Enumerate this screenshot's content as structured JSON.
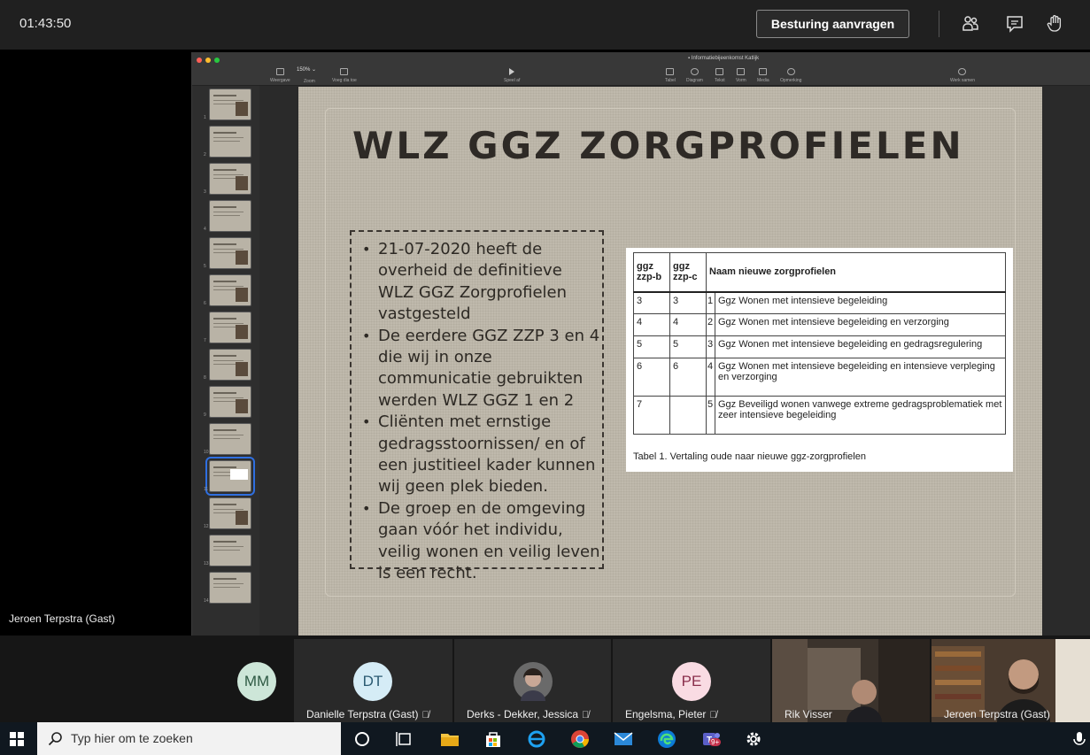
{
  "topbar": {
    "clock": "01:43:50",
    "request_control_label": "Besturing aanvragen"
  },
  "presenter": {
    "name": "Jeroen Terpstra (Gast)"
  },
  "keynote": {
    "doc_title": "Informatiebijeenkomst Katlijk",
    "zoom": "150% ⌄",
    "toolbar": {
      "view": "Weergave",
      "zoom": "Zoom",
      "add_slide": "Voeg dia toe",
      "play": "Speel af",
      "table": "Tabel",
      "chart": "Diagram",
      "text": "Tekst",
      "shape": "Vorm",
      "media": "Media",
      "comment": "Opmerking",
      "collaborate": "Werk samen"
    },
    "slide_numbers": [
      "1",
      "2",
      "3",
      "4",
      "5",
      "6",
      "7",
      "8",
      "9",
      "10",
      "11",
      "12",
      "13",
      "14"
    ]
  },
  "slide": {
    "title": "WLZ GGZ ZORGPROFIELEN",
    "bullets": [
      "21-07-2020 heeft de overheid de definitieve WLZ GGZ Zorgprofielen vastgesteld",
      "De eerdere GGZ ZZP 3 en 4 die wij in onze communicatie gebruikten werden WLZ GGZ 1 en 2",
      "Cliënten met ernstige gedragsstoornissen/ en of een justitieel kader kunnen wij geen plek bieden.",
      "De groep en de omgeving gaan vóór het individu, veilig wonen en veilig leven is een recht."
    ],
    "table": {
      "headers": [
        "ggz zzp-b",
        "ggz zzp-c",
        "Naam nieuwe zorgprofielen"
      ],
      "rows": [
        {
          "b": "3",
          "c": "3",
          "n": "1",
          "name": "Ggz Wonen met intensieve begeleiding"
        },
        {
          "b": "4",
          "c": "4",
          "n": "2",
          "name": "Ggz Wonen met intensieve begeleiding en verzorging"
        },
        {
          "b": "5",
          "c": "5",
          "n": "3",
          "name": "Ggz Wonen met intensieve begeleiding en gedragsregulering"
        },
        {
          "b": "6",
          "c": "6",
          "n": "4",
          "name": "Ggz Wonen met intensieve begeleiding en intensieve verpleging en verzorging"
        },
        {
          "b": "7",
          "c": "",
          "n": "5",
          "name": "Ggz Beveiligd wonen vanwege extreme gedragsproblematiek met zeer intensieve begeleiding"
        }
      ],
      "caption": "Tabel 1. Vertaling oude naar nieuwe ggz-zorgprofielen"
    }
  },
  "participants": [
    {
      "initials": "MM",
      "name": "",
      "bg": "#cde6d8"
    },
    {
      "initials": "DT",
      "name": "Danielle Terpstra (Gast)",
      "bg": "#d5ecf6"
    },
    {
      "initials": "",
      "name": "Derks - Dekker, Jessica",
      "bg": "#555"
    },
    {
      "initials": "PE",
      "name": "Engelsma, Pieter",
      "bg": "#f9dbe3"
    },
    {
      "initials": "",
      "name": "Rik Visser",
      "bg": "#3b332c"
    },
    {
      "initials": "",
      "name": "Jeroen Terpstra (Gast)",
      "bg": "#4a3b2f"
    }
  ],
  "taskbar": {
    "search_placeholder": "Typ hier om te zoeken",
    "teams_badge": "9+"
  }
}
